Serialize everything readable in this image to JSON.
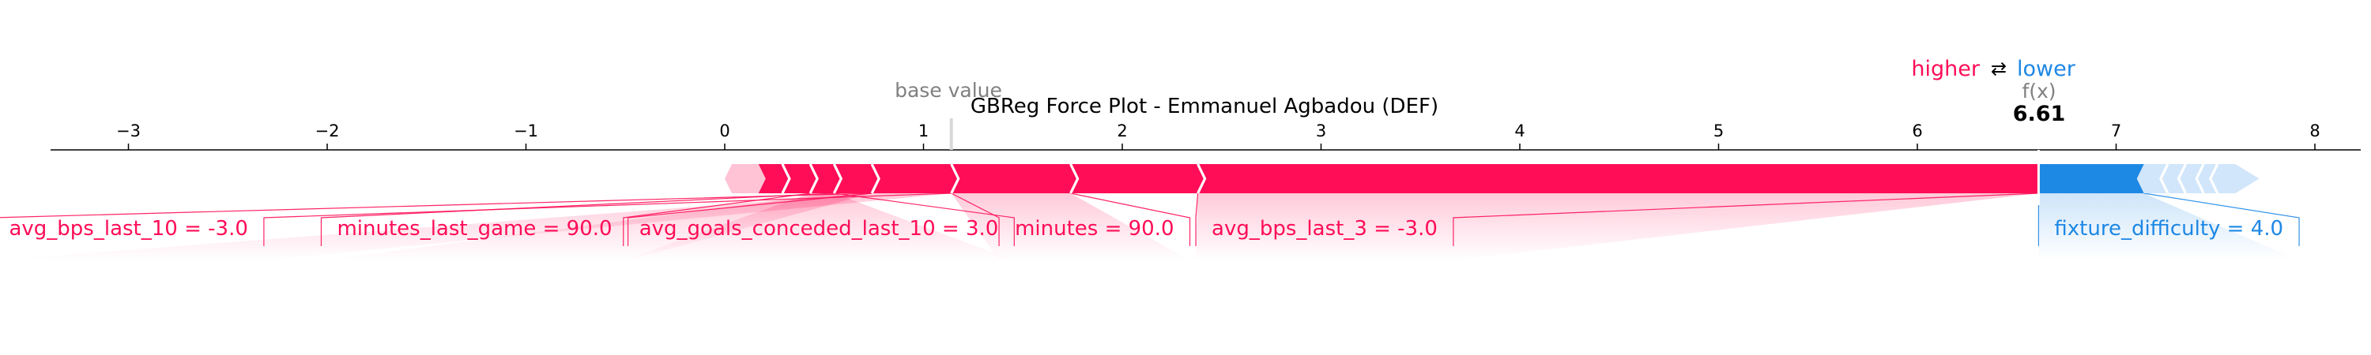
{
  "chart_data": {
    "type": "force",
    "title": "GBReg Force Plot - Emmanuel Agbadou (DEF)",
    "xlim": [
      -3.7,
      8.2
    ],
    "x_ticks": [
      -3,
      -2,
      -1,
      0,
      1,
      2,
      3,
      4,
      5,
      6,
      7,
      8
    ],
    "x_tick_labels": [
      "−3",
      "−2",
      "−1",
      "0",
      "1",
      "2",
      "3",
      "4",
      "5",
      "6",
      "7",
      "8"
    ],
    "base_value": 1.14,
    "base_value_label": "base value",
    "output_value": 6.61,
    "output_value_label": "6.61",
    "output_label": "f(x)",
    "legend": {
      "higher": "higher",
      "arrow": "⇄",
      "lower": "lower"
    },
    "colors": {
      "positive": "#ff0d57",
      "negative": "#1e88e5",
      "positive_light": "#ffc3d5",
      "negative_light": "#d1e6fa",
      "axis": "#000000",
      "base_line": "#d8d8d8"
    },
    "positive_segments": [
      0.0,
      0.17,
      0.29,
      0.43,
      0.55,
      0.74,
      1.14,
      1.74,
      2.38,
      6.61
    ],
    "negative_segments": [
      6.61,
      7.14,
      7.26,
      7.35,
      7.44,
      7.51,
      7.6,
      7.72
    ],
    "features": [
      {
        "label": "avg_bps_last_10 = -3.0",
        "effect": "higher",
        "from": 0.74,
        "to": 1.14,
        "label_x": -3.68
      },
      {
        "label": "minutes_last_game = 90.0",
        "effect": "higher",
        "from": 0.55,
        "to": 0.74,
        "label_x": -2.03
      },
      {
        "label": "avg_goals_conceded_last_10 = 3.0",
        "effect": "higher",
        "from": 0.43,
        "to": 0.55,
        "label_x": -0.51
      },
      {
        "label": "minutes = 90.0",
        "effect": "higher",
        "from": 1.14,
        "to": 1.74,
        "label_x": 1.38
      },
      {
        "label": "avg_bps_last_3 = -3.0",
        "effect": "higher",
        "from": 2.38,
        "to": 6.61,
        "label_x": 2.37
      },
      {
        "label": "fixture_difficulty = 4.0",
        "effect": "lower",
        "from": 6.61,
        "to": 7.14,
        "label_x": 6.61
      }
    ]
  }
}
